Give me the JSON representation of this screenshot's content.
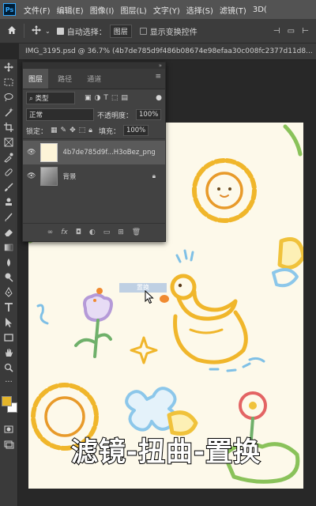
{
  "menubar": {
    "logo": "Ps",
    "items": [
      "文件(F)",
      "编辑(E)",
      "图像(I)",
      "图层(L)",
      "文字(Y)",
      "选择(S)",
      "滤镜(T)",
      "3D("
    ]
  },
  "options": {
    "auto_select_label": "自动选择：",
    "auto_select_value": "图层",
    "transform_label": "显示变换控件"
  },
  "document": {
    "tab_title": "IMG_3195.psd @ 36.7% (4b7de785d9f486b08674e98efaa30c008fc2377d11d8..."
  },
  "layers_panel": {
    "tabs": [
      "图层",
      "路径",
      "通道"
    ],
    "filter_value": "类型",
    "blend_mode": "正常",
    "opacity_label": "不透明度：",
    "opacity_value": "100%",
    "lock_label": "锁定：",
    "fill_label": "填充：",
    "fill_value": "100%",
    "layers": [
      {
        "name": "4b7de785d9f...H3oBez_png",
        "selected": true
      },
      {
        "name": "背景",
        "locked": true
      }
    ],
    "footer_icons": [
      "link-icon",
      "fx-icon",
      "mask-icon",
      "adjustment-icon",
      "folder-icon",
      "new-layer-icon",
      "trash-icon"
    ]
  },
  "drag_ghost": {
    "label": "置换"
  },
  "caption": {
    "text": "滤镜-扭曲-置换"
  },
  "colors": {
    "foreground": "#e5b52a",
    "background": "#ffffff",
    "canvas_bg": "#fdf9ea"
  }
}
